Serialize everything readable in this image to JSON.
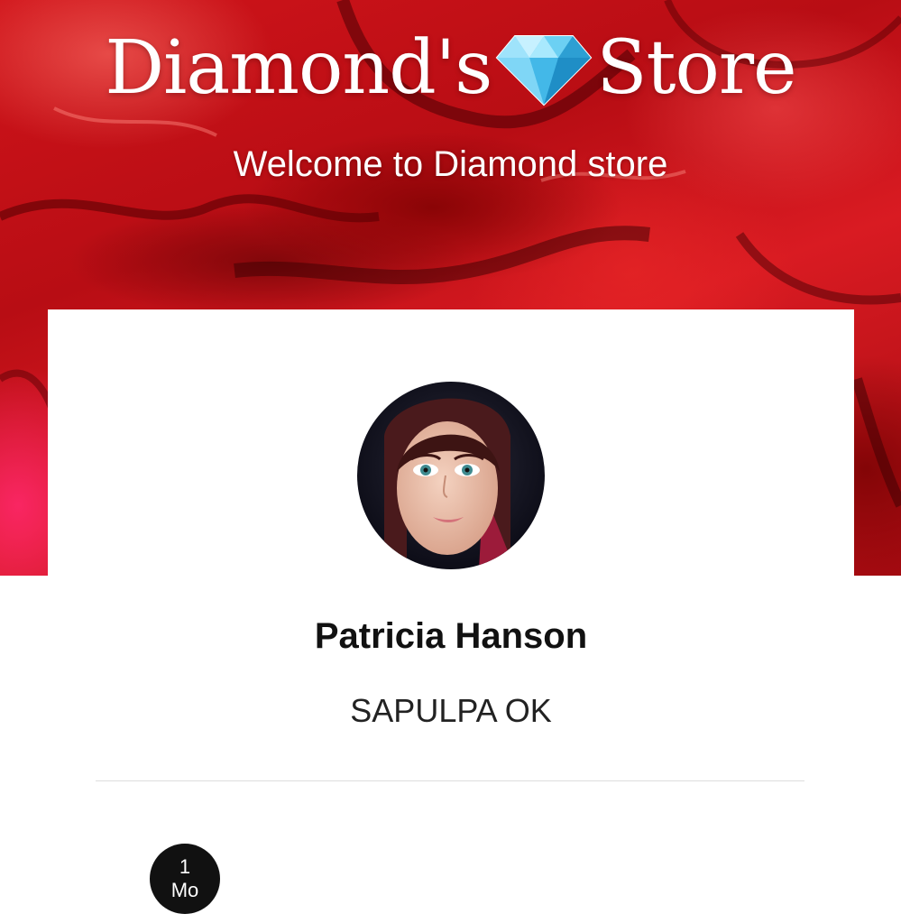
{
  "header": {
    "title_left": "Diamond's",
    "title_icon": "diamond-icon",
    "title_right": "Store",
    "tagline": "Welcome to Diamond store"
  },
  "profile": {
    "avatar_icon": "avatar",
    "name": "Patricia Hanson",
    "location": "SAPULPA OK"
  },
  "membership": {
    "value": "1",
    "unit": "Mo"
  },
  "colors": {
    "hero_red": "#c8141b",
    "diamond_blue": "#3fb6e6",
    "badge_black": "#111111"
  }
}
